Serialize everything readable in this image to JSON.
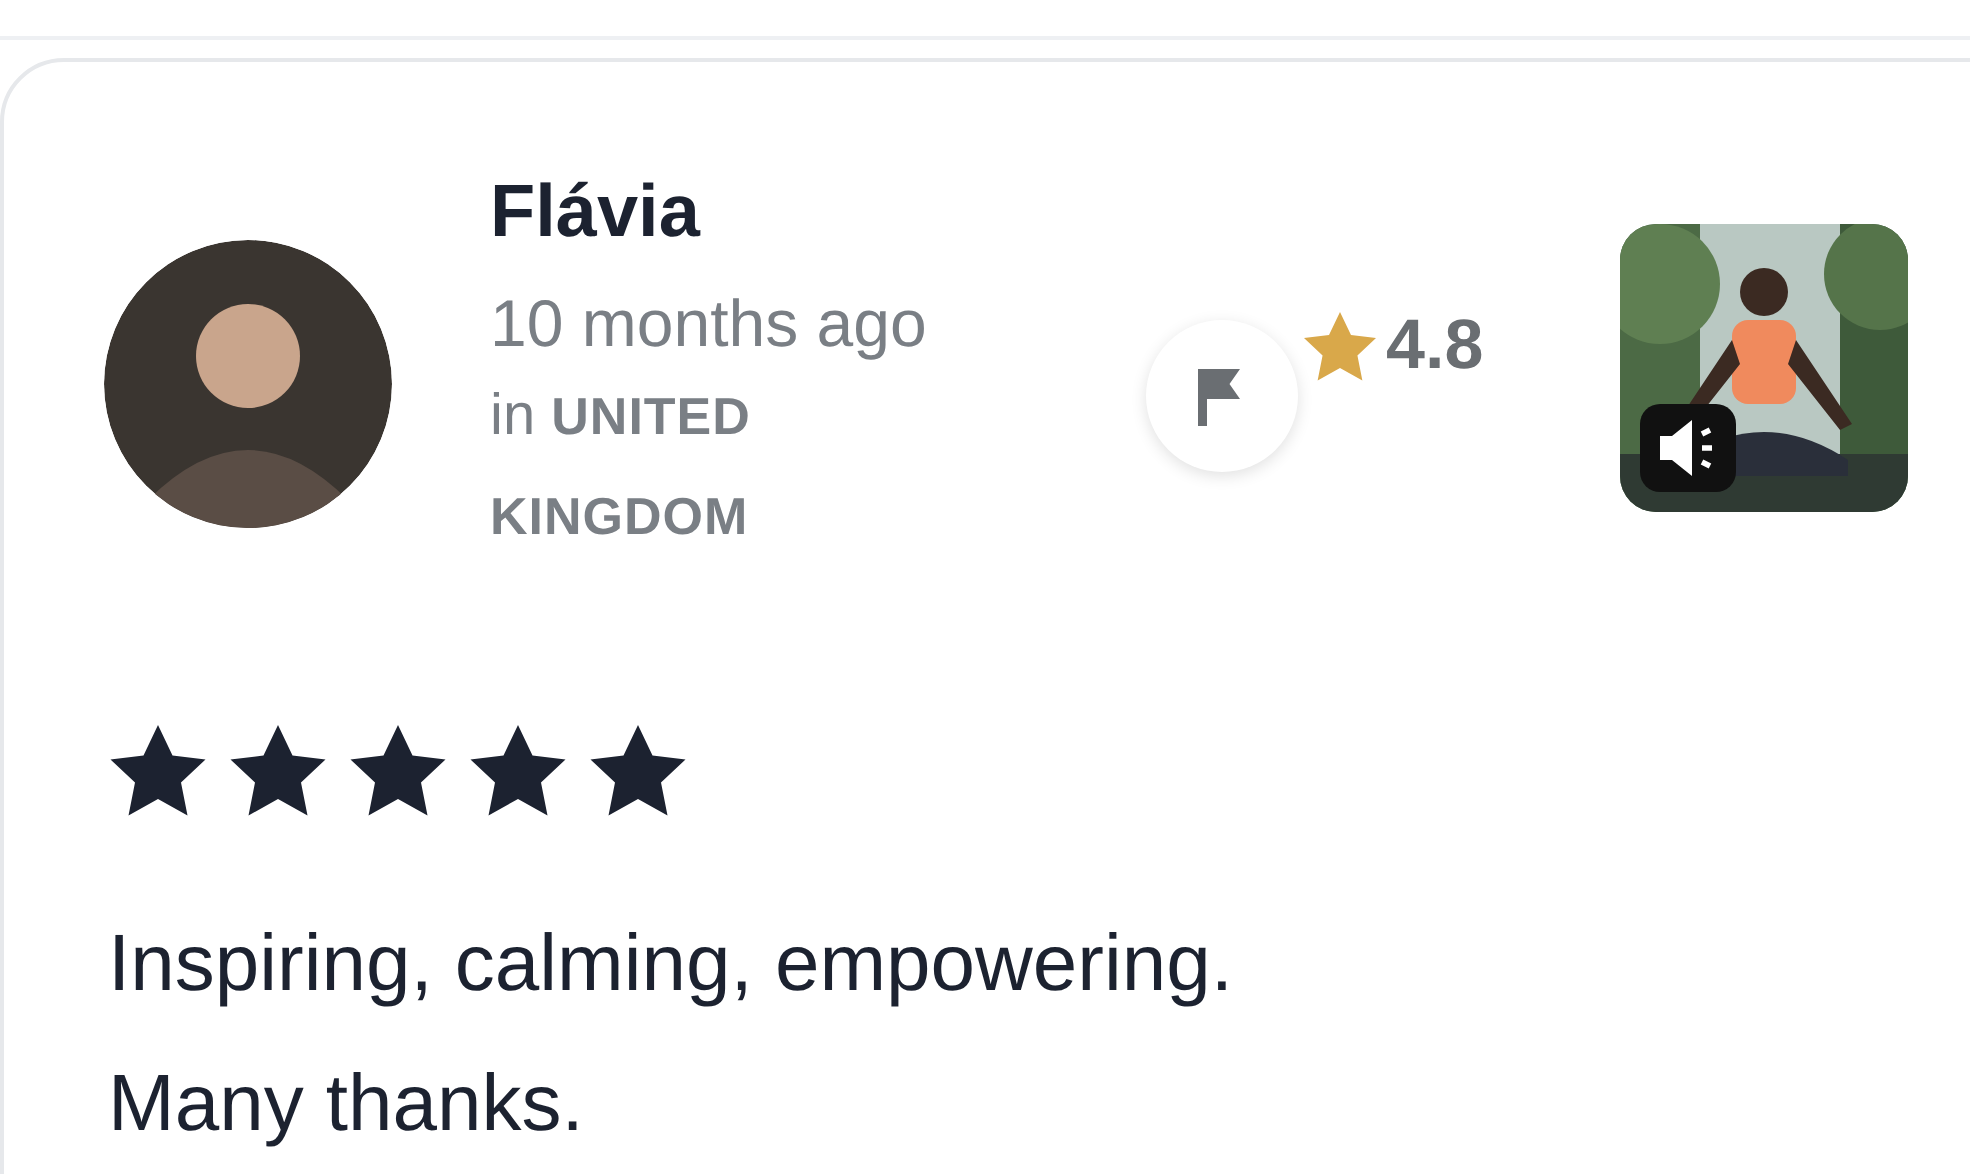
{
  "reviewer": {
    "name": "Flávia",
    "time": "10 months ago",
    "location": "in **UNITED KINGDOM**"
  },
  "teacher_rating": "4.8",
  "track": {
    "kind": "picture",
    "audio": true
  },
  "review": {
    "stars": 5,
    "text": "Inspiring, calming, empowering. Many thanks."
  }
}
